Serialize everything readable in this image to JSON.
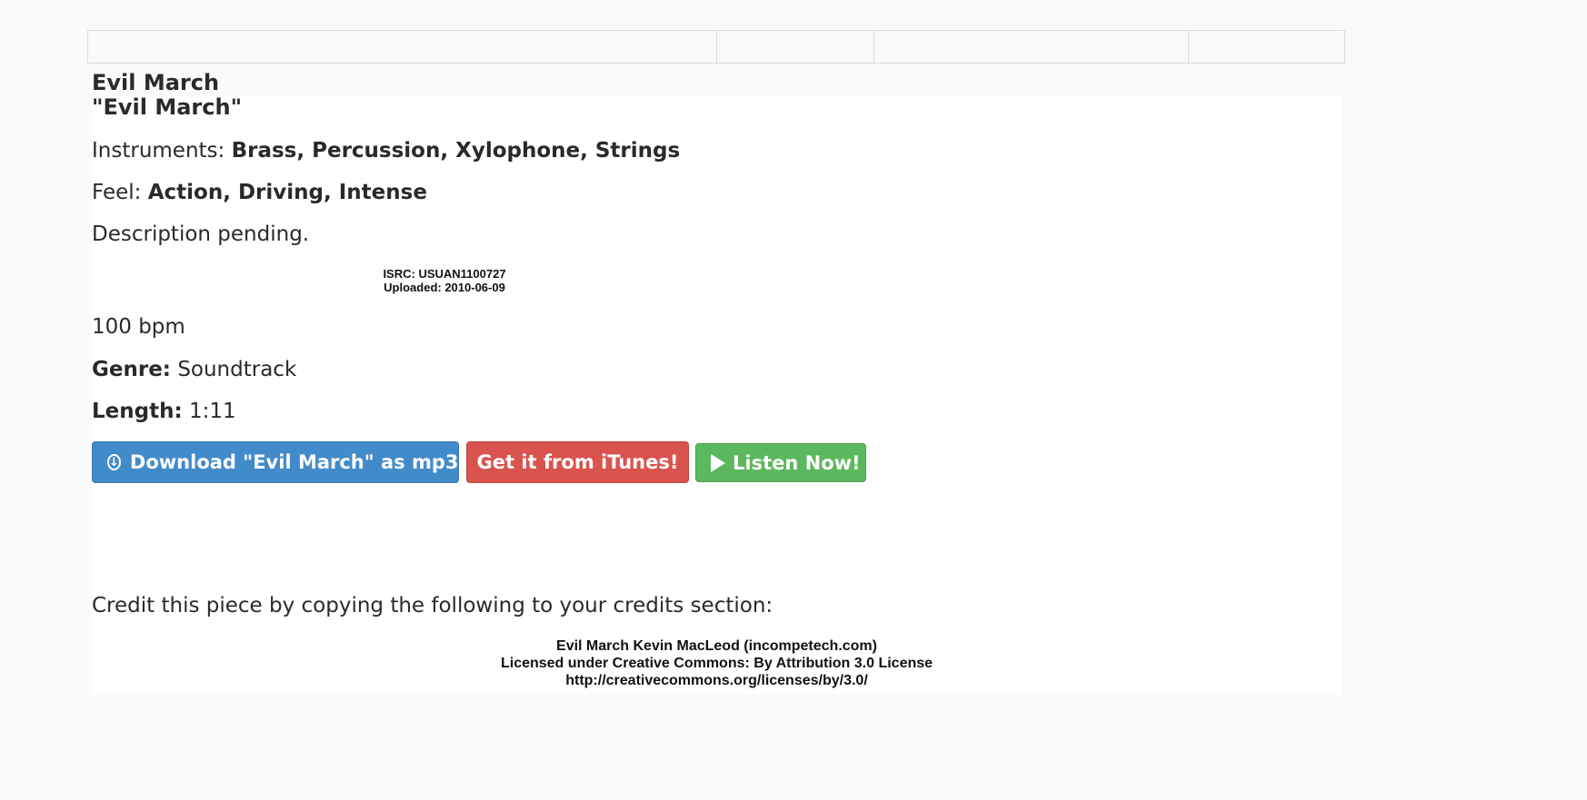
{
  "song": {
    "title": "Evil March",
    "quoted_title": "\"Evil March\""
  },
  "details": {
    "instruments_label": "Instruments:",
    "instruments_value": "Brass, Percussion, Xylophone, Strings",
    "feel_label": "Feel:",
    "feel_value": "Action, Driving, Intense",
    "description": "Description pending.",
    "isrc": "ISRC: USUAN1100727",
    "uploaded": "Uploaded: 2010-06-09",
    "bpm": "100 bpm",
    "genre_label": "Genre:",
    "genre_value": "Soundtrack",
    "length_label": "Length:",
    "length_value": "1:11"
  },
  "buttons": {
    "download": "Download \"Evil March\" as mp3",
    "itunes": "Get it from iTunes!",
    "listen": "Listen Now!"
  },
  "credit": {
    "intro": "Credit this piece by copying the following to your credits section:",
    "line1": "Evil March Kevin MacLeod (incompetech.com)",
    "line2": "Licensed under Creative Commons: By Attribution 3.0 License",
    "line3": "http://creativecommons.org/licenses/by/3.0/"
  },
  "colors": {
    "download": "#428bca",
    "itunes": "#d9534f",
    "listen": "#5cb85c"
  },
  "icons": {
    "download": "download-circle-icon",
    "listen": "play-icon"
  }
}
